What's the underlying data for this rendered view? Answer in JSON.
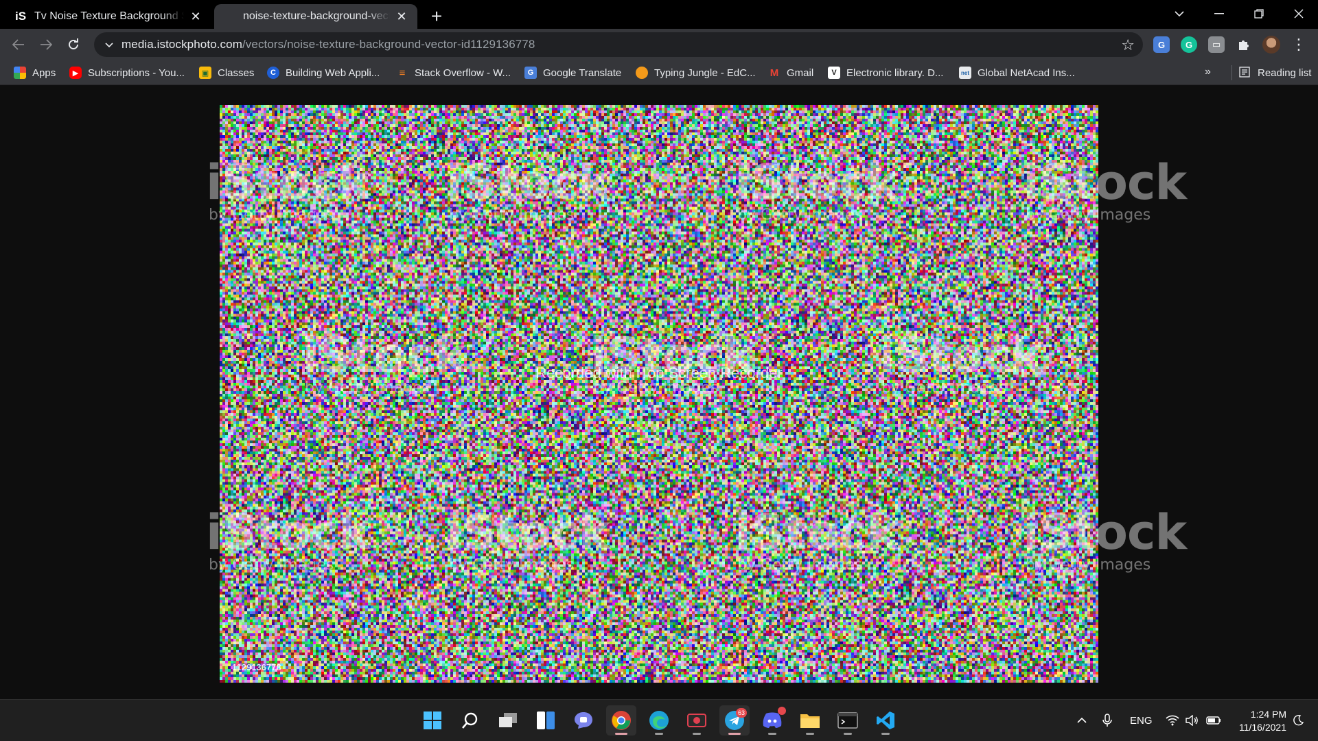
{
  "browser": {
    "tabs": [
      {
        "title": "Tv Noise Texture Background Stock",
        "favicon": "iS",
        "active": false
      },
      {
        "title": "noise-texture-background-vector",
        "active": true
      }
    ],
    "url": {
      "host": "media.istockphoto.com",
      "path": "/vectors/noise-texture-background-vector-id1129136778"
    },
    "bookmarks": [
      {
        "label": "Apps",
        "icon": "apps-grid-icon"
      },
      {
        "label": "Subscriptions - You...",
        "icon": "youtube-icon"
      },
      {
        "label": "Classes",
        "icon": "classroom-icon"
      },
      {
        "label": "Building Web Appli...",
        "icon": "coursera-icon"
      },
      {
        "label": "Stack Overflow - W...",
        "icon": "stackoverflow-icon"
      },
      {
        "label": "Google Translate",
        "icon": "google-translate-icon"
      },
      {
        "label": "Typing Jungle - EdC...",
        "icon": "edclub-icon"
      },
      {
        "label": "Gmail",
        "icon": "gmail-icon"
      },
      {
        "label": "Electronic library. D...",
        "icon": "vlib-icon"
      },
      {
        "label": "Global NetAcad Ins...",
        "icon": "netacad-icon"
      }
    ],
    "reading_list": "Reading list",
    "overflow": "»"
  },
  "image": {
    "watermark": {
      "brand": "iStock",
      "sub": "by Getty Images"
    },
    "recorder_text": "Recorded with iTop Screen Recorder",
    "image_id": "1129136778"
  },
  "taskbar": {
    "apps": [
      {
        "name": "start-icon"
      },
      {
        "name": "search-icon"
      },
      {
        "name": "task-view-icon"
      },
      {
        "name": "widgets-icon"
      },
      {
        "name": "teams-chat-icon"
      },
      {
        "name": "chrome-icon"
      },
      {
        "name": "edge-icon"
      },
      {
        "name": "screen-recorder-icon"
      },
      {
        "name": "telegram-icon",
        "badge": "63"
      },
      {
        "name": "discord-icon"
      },
      {
        "name": "file-explorer-icon"
      },
      {
        "name": "terminal-icon"
      },
      {
        "name": "vscode-icon"
      }
    ],
    "tray": {
      "language": "ENG",
      "time": "1:24 PM",
      "date": "11/16/2021"
    }
  },
  "colors": {
    "tabstrip": "#000000",
    "toolbar": "#35363a",
    "omnibox": "#202124",
    "taskbar": "#202020"
  }
}
